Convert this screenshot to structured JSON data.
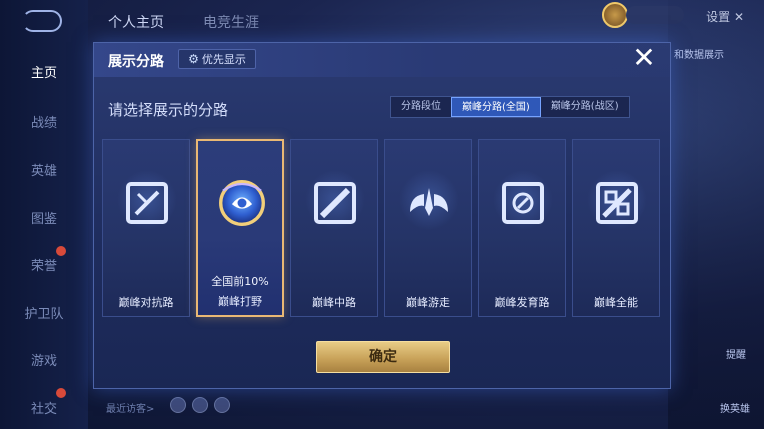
{
  "nav": {
    "items": [
      {
        "label": "主页",
        "active": true
      },
      {
        "label": "战绩",
        "active": false
      },
      {
        "label": "英雄",
        "active": false
      },
      {
        "label": "图鉴",
        "active": false
      },
      {
        "label": "荣誉",
        "active": false
      },
      {
        "label": "护卫队",
        "active": false
      },
      {
        "label": "游戏",
        "active": false
      },
      {
        "label": "社交",
        "active": false
      }
    ]
  },
  "top": {
    "tabs": [
      "个人主页",
      "电竞生涯"
    ],
    "settings_label": "设置",
    "side_text": "和数据展示"
  },
  "bottom": {
    "visitors_label": "最近访客>"
  },
  "right": {
    "caption1": "提醒",
    "caption2": "换英雄"
  },
  "modal": {
    "title": "展示分路",
    "priority_label": "优先显示",
    "close_icon": "close-icon",
    "section_title": "请选择展示的分路",
    "segments": [
      {
        "label": "分路段位",
        "active": false
      },
      {
        "label": "巅峰分路(全国)",
        "active": true
      },
      {
        "label": "巅峰分路(战区)",
        "active": false
      }
    ],
    "cards": [
      {
        "label": "巅峰对抗路",
        "icon": "clash-lane-icon",
        "selected": false,
        "rank": ""
      },
      {
        "label": "巅峰打野",
        "icon": "jungle-emblem-icon",
        "selected": true,
        "rank": "全国前10%"
      },
      {
        "label": "巅峰中路",
        "icon": "mid-lane-icon",
        "selected": false,
        "rank": ""
      },
      {
        "label": "巅峰游走",
        "icon": "roam-wings-icon",
        "selected": false,
        "rank": ""
      },
      {
        "label": "巅峰发育路",
        "icon": "farm-lane-icon",
        "selected": false,
        "rank": ""
      },
      {
        "label": "巅峰全能",
        "icon": "all-round-icon",
        "selected": false,
        "rank": ""
      }
    ],
    "confirm_label": "确定"
  },
  "colors": {
    "accent_gold": "#e9b874",
    "segment_active": "#2f58b8",
    "confirm_button": "#c9a35a"
  }
}
